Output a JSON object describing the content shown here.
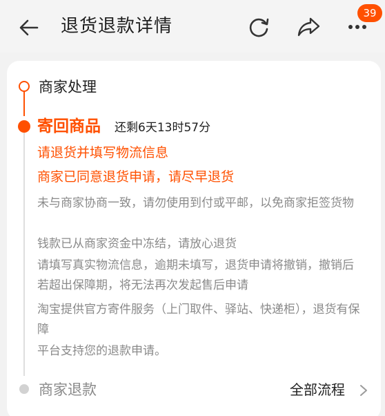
{
  "header": {
    "title": "退货退款详情",
    "notification_count": "39"
  },
  "timeline": {
    "step1_label": "商家处理",
    "step2_title": "寄回商品",
    "step2_countdown": "还剩6天13时57分",
    "orange_lines": [
      "请退货并填写物流信息",
      "商家已同意退货申请，请尽早退货"
    ],
    "notes": [
      "未与商家协商一致，请勿使用到付或平邮，以免商家拒签货物",
      "钱款已从商家资金中冻结，请放心退货",
      "请填写真实物流信息，逾期未填写，退货申请将撤销，撤销后若超出保障期，将无法再次发起售后申请",
      "淘宝提供官方寄件服务（上门取件、驿站、快递柜），退货有保障",
      "平台支持您的退款申请。"
    ],
    "step3_label": "商家退款",
    "all_flow_label": "全部流程"
  },
  "colors": {
    "accent": "#ff5000",
    "text_primary": "#1f1f1f",
    "text_secondary": "#8a8a8a",
    "background": "#f2f2f2"
  },
  "icons": [
    "back-arrow-icon",
    "refresh-icon",
    "share-icon",
    "more-icon",
    "chevron-right-icon"
  ]
}
